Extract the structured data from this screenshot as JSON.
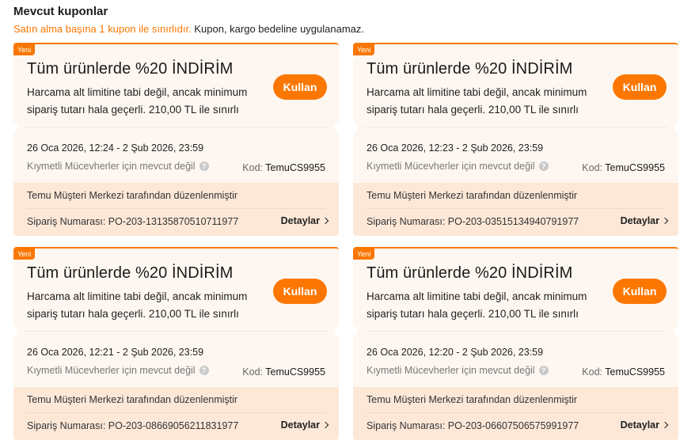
{
  "header": {
    "title": "Mevcut kuponlar",
    "subtitle_accent": "Satın alma başına 1 kupon ile sınırlıdır.",
    "subtitle_rest": " Kupon, kargo bedeline uygulanamaz."
  },
  "colors": {
    "accent": "#fb7701",
    "card_bg": "#fef7f1",
    "card_lower_bg": "#fde8d8"
  },
  "coupons": [
    {
      "badge": "Yeni",
      "title": "Tüm ürünlerde %20 İNDİRİM",
      "description": "Harcama alt limitine tabi değil, ancak minimum sipariş tutarı hala geçerli. 210,00 TL ile sınırlı",
      "button": "Kullan",
      "validity": "26 Oca 2026, 12:24 - 2 Şub 2026, 23:59",
      "exclusion": "Kıymetli Mücevherler için mevcut değil",
      "code_label": "Kod:",
      "code": "TemuCS9955",
      "issuer": "Temu Müşteri Merkezi tarafından düzenlenmiştir",
      "order": "Sipariş Numarası: PO-203-13135870510711977",
      "details": "Detaylar"
    },
    {
      "badge": "Yeni",
      "title": "Tüm ürünlerde %20 İNDİRİM",
      "description": "Harcama alt limitine tabi değil, ancak minimum sipariş tutarı hala geçerli. 210,00 TL ile sınırlı",
      "button": "Kullan",
      "validity": "26 Oca 2026, 12:23 - 2 Şub 2026, 23:59",
      "exclusion": "Kıymetli Mücevherler için mevcut değil",
      "code_label": "Kod:",
      "code": "TemuCS9955",
      "issuer": "Temu Müşteri Merkezi tarafından düzenlenmiştir",
      "order": "Sipariş Numarası: PO-203-03515134940791977",
      "details": "Detaylar"
    },
    {
      "badge": "Yeni",
      "title": "Tüm ürünlerde %20 İNDİRİM",
      "description": "Harcama alt limitine tabi değil, ancak minimum sipariş tutarı hala geçerli. 210,00 TL ile sınırlı",
      "button": "Kullan",
      "validity": "26 Oca 2026, 12:21 - 2 Şub 2026, 23:59",
      "exclusion": "Kıymetli Mücevherler için mevcut değil",
      "code_label": "Kod:",
      "code": "TemuCS9955",
      "issuer": "Temu Müşteri Merkezi tarafından düzenlenmiştir",
      "order": "Sipariş Numarası: PO-203-08669056211831977",
      "details": "Detaylar"
    },
    {
      "badge": "Yeni",
      "title": "Tüm ürünlerde %20 İNDİRİM",
      "description": "Harcama alt limitine tabi değil, ancak minimum sipariş tutarı hala geçerli. 210,00 TL ile sınırlı",
      "button": "Kullan",
      "validity": "26 Oca 2026, 12:20 - 2 Şub 2026, 23:59",
      "exclusion": "Kıymetli Mücevherler için mevcut değil",
      "code_label": "Kod:",
      "code": "TemuCS9955",
      "issuer": "Temu Müşteri Merkezi tarafından düzenlenmiştir",
      "order": "Sipariş Numarası: PO-203-06607506575991977",
      "details": "Detaylar"
    }
  ]
}
